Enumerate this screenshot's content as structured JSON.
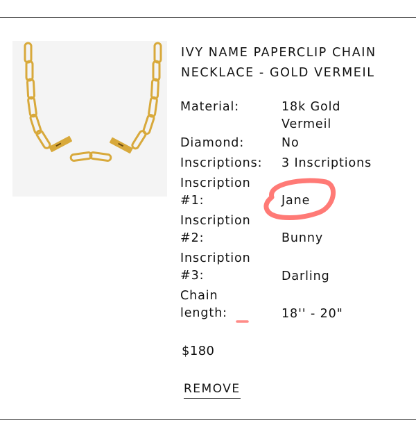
{
  "product": {
    "title_line1": "IVY NAME PAPERCLIP CHAIN",
    "title_line2": "NECKLACE - GOLD VERMEIL",
    "image_icon": "necklace-image",
    "attributes": [
      {
        "label": "Material:",
        "value_line1": "18k Gold",
        "value_line2": "Vermeil"
      },
      {
        "label": "Diamond:",
        "value": "No"
      },
      {
        "label": "Inscriptions:",
        "value": "3 Inscriptions"
      },
      {
        "label_line1": "Inscription",
        "label_line2": "#1:",
        "value": "Jane"
      },
      {
        "label_line1": "Inscription",
        "label_line2": "#2:",
        "value": "Bunny"
      },
      {
        "label_line1": "Inscription",
        "label_line2": "#3:",
        "value": "Darling"
      },
      {
        "label_line1": "Chain",
        "label_line2": "length:",
        "value": "18'' - 20\""
      }
    ],
    "price": "$180",
    "remove_label": "REMOVE"
  },
  "colors": {
    "annotation_circle": "#ff6f6a",
    "gold": "#d8a93b",
    "image_background": "#f4f4f4"
  }
}
